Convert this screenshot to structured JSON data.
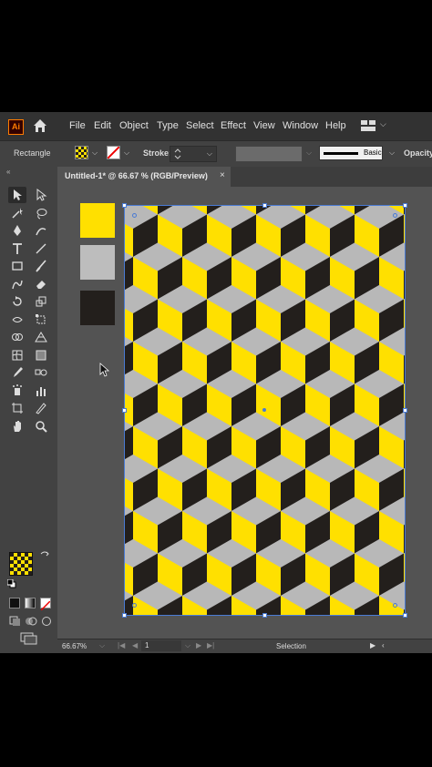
{
  "app": {
    "logo_text": "Ai"
  },
  "menu": [
    "File",
    "Edit",
    "Object",
    "Type",
    "Select",
    "Effect",
    "View",
    "Window",
    "Help"
  ],
  "control_bar": {
    "selection_name": "Rectangle",
    "stroke_label": "Stroke:",
    "brush_label": "Basic",
    "opacity_label": "Opacity:"
  },
  "document_tab": {
    "title": "Untitled-1* @ 66.67 % (RGB/Preview)",
    "close": "×"
  },
  "document_swatches": [
    {
      "name": "yellow",
      "color": "#ffe000"
    },
    {
      "name": "gray",
      "color": "#bdbdbd"
    },
    {
      "name": "black",
      "color": "#231f1c"
    }
  ],
  "pattern": {
    "type": "isometric-cubes",
    "colors": {
      "top": "#b8b8b8",
      "left": "#ffe000",
      "right": "#231f1c"
    }
  },
  "tools": [
    "selection-tool",
    "direct-selection-tool",
    "magic-wand-tool",
    "lasso-tool",
    "pen-tool",
    "curvature-tool",
    "type-tool",
    "line-segment-tool",
    "rectangle-tool",
    "paintbrush-tool",
    "shaper-tool",
    "eraser-tool",
    "rotate-tool",
    "scale-tool",
    "width-tool",
    "free-transform-tool",
    "shape-builder-tool",
    "perspective-grid-tool",
    "mesh-tool",
    "gradient-tool",
    "eyedropper-tool",
    "blend-tool",
    "symbol-sprayer-tool",
    "column-graph-tool",
    "artboard-tool",
    "slice-tool",
    "hand-tool",
    "zoom-tool"
  ],
  "status_bar": {
    "zoom": "66.67%",
    "page": "1",
    "tool": "Selection"
  },
  "more_tools": "..."
}
